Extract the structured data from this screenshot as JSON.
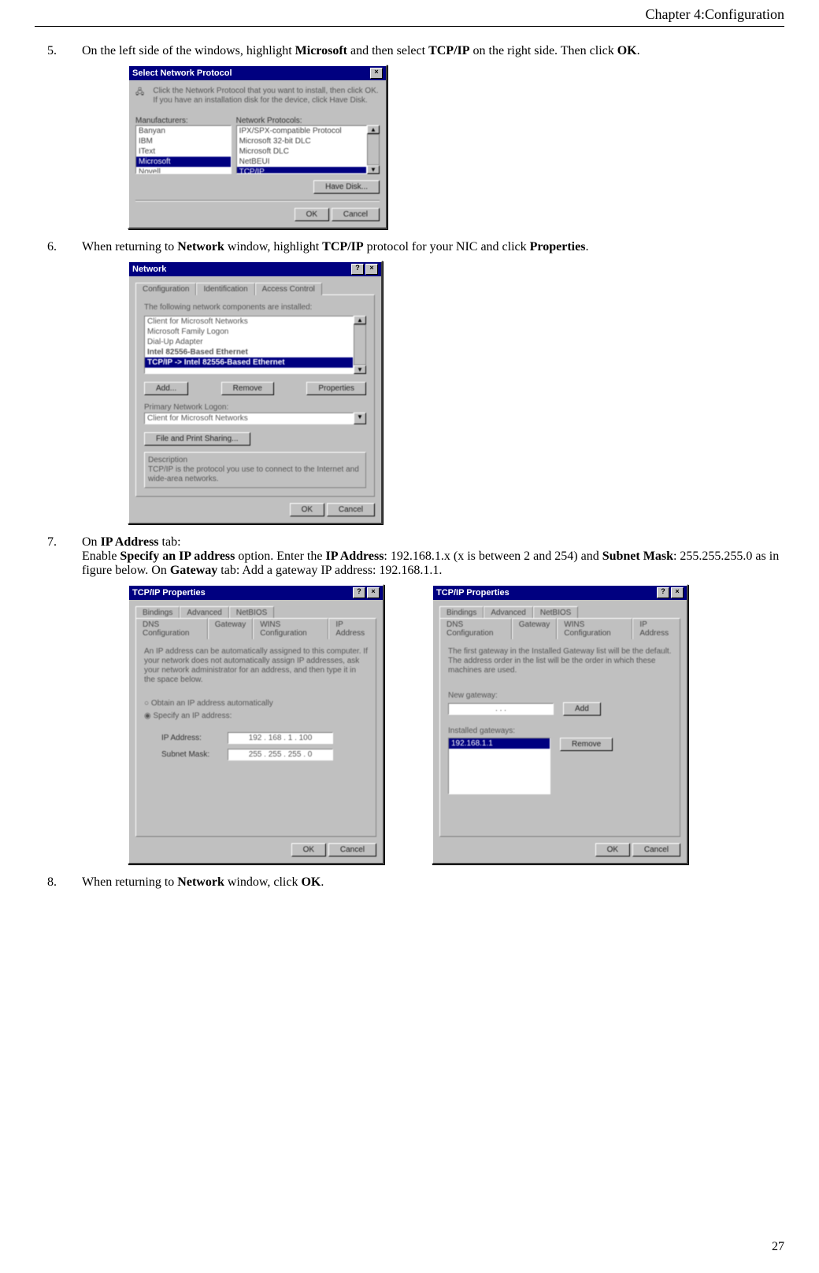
{
  "header": {
    "chapter": "Chapter 4:Configuration"
  },
  "pageNumber": "27",
  "steps": {
    "s5": {
      "num": "5.",
      "t1": "On the left side of the windows, highlight ",
      "b1": "Microsoft",
      "t2": " and then select ",
      "b2": "TCP/IP",
      "t3": " on the right side. Then click ",
      "b3": "OK",
      "t4": "."
    },
    "s6": {
      "num": "6.",
      "t1": "When returning to ",
      "b1": "Network",
      "t2": " window, highlight ",
      "b2": "TCP/IP",
      "t3": " protocol for your NIC and click ",
      "b3": "Properties",
      "t4": "."
    },
    "s7": {
      "num": "7.",
      "t1": "On ",
      "b1": "IP Address",
      "t2": " tab:",
      "line2a": "Enable ",
      "b2": "Specify an IP address",
      "line2b": " option. Enter the ",
      "b3": "IP Address",
      "line2c": ": 192.168.1.x (x is between 2 and 254) and ",
      "b4": "Subnet",
      "b5": "Mask",
      "line3a": ": 255.255.255.0 as in figure below. On ",
      "b6": "Gateway",
      "line3b": " tab: Add a gateway IP address: 192.168.1.1."
    },
    "s8": {
      "num": "8.",
      "t1": "When returning to ",
      "b1": "Network",
      "t2": " window, click ",
      "b2": "OK",
      "t3": "."
    }
  },
  "dlgProtocol": {
    "title": "Select Network Protocol",
    "hint": "Click the Network Protocol that you want to install, then click OK. If you have an installation disk for the device, click Have Disk.",
    "manuLabel": "Manufacturers:",
    "protoLabel": "Network Protocols:",
    "manufacturers": [
      "Banyan",
      "IBM",
      "IText",
      "Microsoft",
      "Novell"
    ],
    "manuSelectedIndex": 3,
    "protocols": [
      "IPX/SPX-compatible Protocol",
      "Microsoft 32-bit DLC",
      "Microsoft DLC",
      "NetBEUI",
      "TCP/IP"
    ],
    "protoSelectedIndex": 4,
    "haveDisk": "Have Disk...",
    "ok": "OK",
    "cancel": "Cancel"
  },
  "dlgNetwork": {
    "title": "Network",
    "tabs": [
      "Configuration",
      "Identification",
      "Access Control"
    ],
    "componentsLabel": "The following network components are installed:",
    "components": [
      "Client for Microsoft Networks",
      "Microsoft Family Logon",
      "Dial-Up Adapter",
      "Intel 82556-Based Ethernet",
      "TCP/IP -> Intel 82556-Based Ethernet"
    ],
    "compSelectedIndex": 4,
    "add": "Add...",
    "remove": "Remove",
    "properties": "Properties",
    "primaryLabel": "Primary Network Logon:",
    "primaryValue": "Client for Microsoft Networks",
    "filePrint": "File and Print Sharing...",
    "descLabel": "Description",
    "descText": "TCP/IP is the protocol you use to connect to the Internet and wide-area networks.",
    "ok": "OK",
    "cancel": "Cancel"
  },
  "dlgIP": {
    "title": "TCP/IP Properties",
    "tabsTop": [
      "Bindings",
      "Advanced",
      "NetBIOS"
    ],
    "tabsBottom": [
      "DNS Configuration",
      "Gateway",
      "WINS Configuration",
      "IP Address"
    ],
    "intro": "An IP address can be automatically assigned to this computer. If your network does not automatically assign IP addresses, ask your network administrator for an address, and then type it in the space below.",
    "optAuto": "Obtain an IP address automatically",
    "optManual": "Specify an IP address:",
    "ipLabel": "IP Address:",
    "ipValue": "192 . 168 .  1  . 100",
    "maskLabel": "Subnet Mask:",
    "maskValue": "255 . 255 . 255 .  0",
    "ok": "OK",
    "cancel": "Cancel"
  },
  "dlgGW": {
    "title": "TCP/IP Properties",
    "tabsTop": [
      "Bindings",
      "Advanced",
      "NetBIOS"
    ],
    "tabsBottom": [
      "DNS Configuration",
      "Gateway",
      "WINS Configuration",
      "IP Address"
    ],
    "intro": "The first gateway in the Installed Gateway list will be the default. The address order in the list will be the order in which these machines are used.",
    "newLabel": "New gateway:",
    "newValue": " .    .    .   ",
    "add": "Add",
    "installedLabel": "Installed gateways:",
    "installedValue": "192.168.1.1",
    "remove": "Remove",
    "ok": "OK",
    "cancel": "Cancel"
  }
}
